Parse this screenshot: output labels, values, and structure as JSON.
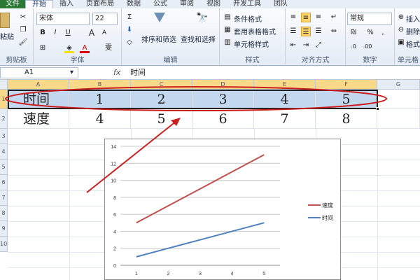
{
  "tabs": [
    "文件",
    "开始",
    "插入",
    "页面布局",
    "数据",
    "公式",
    "审阅",
    "视图",
    "开发工具",
    "团队"
  ],
  "active_tab": "开始",
  "ribbon": {
    "clipboard": {
      "label": "剪贴板",
      "paste": "粘贴"
    },
    "font": {
      "label": "字体",
      "family": "宋体",
      "size": "22",
      "bold": "B",
      "italic": "I",
      "underline": "U",
      "grow": "A",
      "shrink": "A",
      "phonetic": "雯"
    },
    "editing": {
      "label": "编辑",
      "sigma": "Σ",
      "sort": "排序和筛选",
      "find": "查找和选择"
    },
    "styles": {
      "label": "样式",
      "conditional": "条件格式",
      "table": "套用表格格式",
      "cell": "单元格样式"
    },
    "alignment": {
      "label": "对齐方式"
    },
    "number": {
      "label": "数字",
      "format": "常规",
      "percent": "%",
      "comma": ","
    },
    "cells": {
      "label": "单元格",
      "insert": "插入",
      "delete": "删除",
      "format": "格式"
    }
  },
  "name_box": "A1",
  "fx_label": "fx",
  "formula": "时间",
  "columns": [
    "A",
    "B",
    "C",
    "D",
    "E",
    "F",
    "G"
  ],
  "rows": [
    "1",
    "2",
    "3",
    "4",
    "5",
    "6",
    "7",
    "8",
    "9",
    "10"
  ],
  "table": {
    "row1": {
      "label": "时间",
      "values": [
        "1",
        "2",
        "3",
        "4",
        "5"
      ]
    },
    "row2": {
      "label": "速度",
      "values": [
        "4",
        "5",
        "6",
        "7",
        "8"
      ]
    }
  },
  "annotation_color": "#cc1f1f",
  "chart_data": {
    "type": "line",
    "categories": [
      1,
      2,
      3,
      4,
      5
    ],
    "series": [
      {
        "name": "速度",
        "values": [
          5,
          7,
          9,
          11,
          13
        ],
        "color": "#c0504d"
      },
      {
        "name": "时间",
        "values": [
          1,
          2,
          3,
          4,
          5
        ],
        "color": "#4f81bd"
      }
    ],
    "ylim": [
      0,
      14
    ],
    "yticks": [
      0,
      2,
      4,
      6,
      8,
      10,
      12,
      14
    ],
    "grid": true,
    "legend": "right"
  }
}
